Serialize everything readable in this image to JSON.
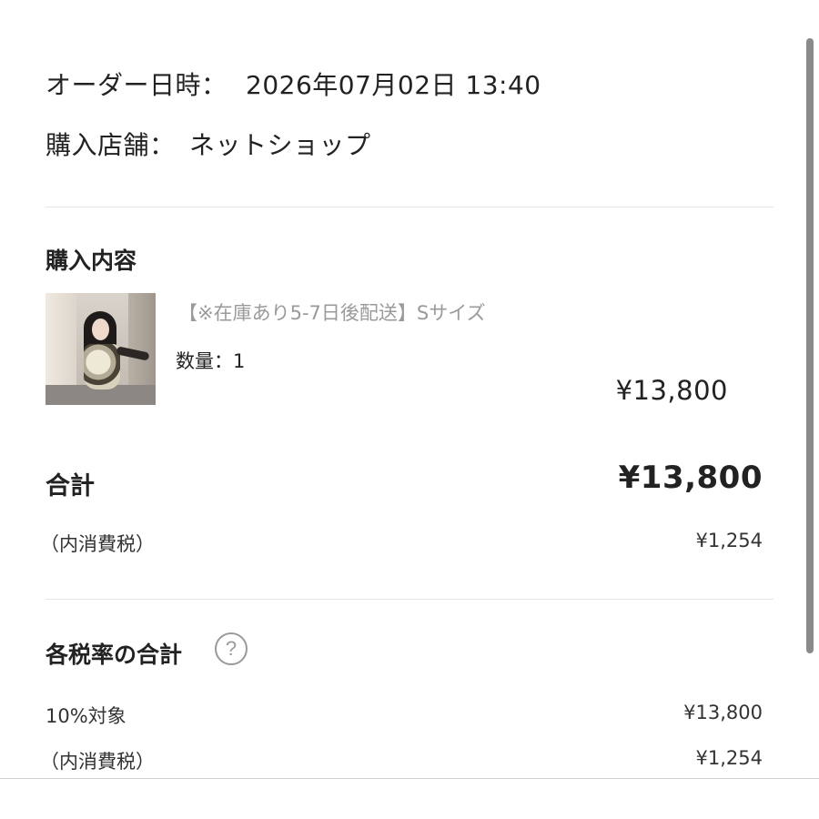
{
  "order": {
    "datetime_label": "オーダー日時：",
    "datetime_value": "2026年07月02日 13:40",
    "store_label": "購入店舗：",
    "store_value": "ネットショップ"
  },
  "purchase": {
    "section_title": "購入内容",
    "item": {
      "name": "【※在庫あり5-7日後配送】Sサイズ",
      "quantity_text": "数量：1",
      "price": "¥13,800"
    }
  },
  "totals": {
    "total_label": "合計",
    "total_value": "¥13,800",
    "tax_label": "（内消費税）",
    "tax_value": "¥1,254"
  },
  "tax_rates": {
    "section_title": "各税率の合計",
    "help_icon": "question-circle-icon",
    "help_glyph": "?",
    "rows": [
      {
        "label": "10%対象",
        "value": "¥13,800"
      },
      {
        "label": "（内消費税）",
        "value": "¥1,254"
      }
    ]
  },
  "colors": {
    "text": "#222222",
    "muted": "#9a9a9a",
    "divider": "#e6e6e6",
    "scrollbar": "#8a8a8a"
  }
}
